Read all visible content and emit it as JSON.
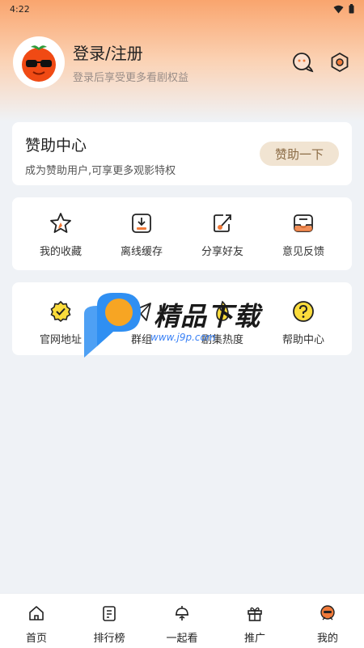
{
  "status_bar": {
    "time": "4:22"
  },
  "profile": {
    "title": "登录/注册",
    "subtitle": "登录后享受更多看剧权益"
  },
  "sponsor": {
    "title": "赞助中心",
    "subtitle": "成为赞助用户,可享更多观影特权",
    "button": "赞助一下"
  },
  "row1": [
    {
      "label": "我的收藏",
      "icon": "star-icon"
    },
    {
      "label": "离线缓存",
      "icon": "download-icon"
    },
    {
      "label": "分享好友",
      "icon": "share-icon"
    },
    {
      "label": "意见反馈",
      "icon": "feedback-inbox-icon"
    }
  ],
  "row2": [
    {
      "label": "官网地址",
      "icon": "verified-badge-icon"
    },
    {
      "label": "群组",
      "icon": "paper-plane-icon"
    },
    {
      "label": "剧集热度",
      "icon": "fire-icon"
    },
    {
      "label": "帮助中心",
      "icon": "question-icon"
    }
  ],
  "watermark": {
    "text": "精品下载",
    "url": "www.j9p.com"
  },
  "bottom_nav": [
    {
      "label": "首页",
      "icon": "home-icon"
    },
    {
      "label": "排行榜",
      "icon": "ranking-icon"
    },
    {
      "label": "一起看",
      "icon": "watch-together-icon"
    },
    {
      "label": "推广",
      "icon": "gift-icon"
    },
    {
      "label": "我的",
      "icon": "profile-icon"
    }
  ],
  "colors": {
    "accent": "#f07a3a",
    "header_gradient_top": "#f9a56e",
    "sponsor_button_bg": "#f1e4d2",
    "sponsor_button_text": "#8a6a44"
  }
}
